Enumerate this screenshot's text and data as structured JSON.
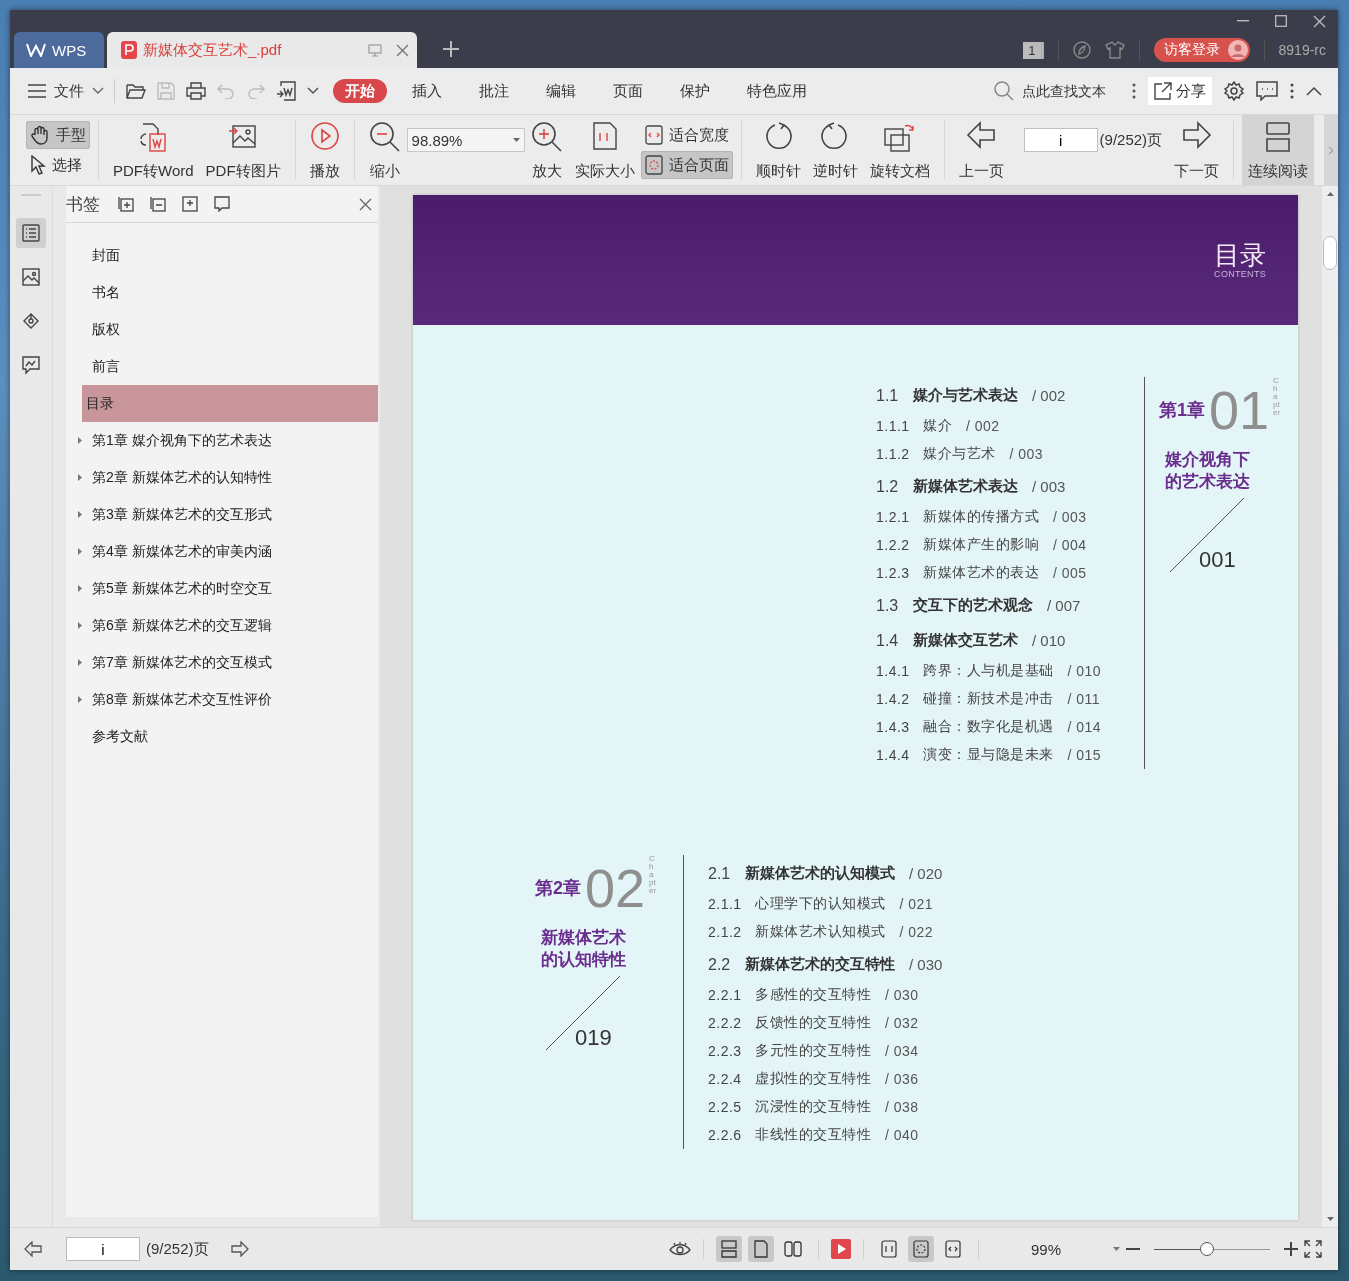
{
  "title_bar": {
    "tabs": [
      {
        "label": "WPS",
        "kind": "home",
        "selected": false
      },
      {
        "label": "新媒体交互艺术_.pdf",
        "kind": "doc",
        "selected": true
      }
    ],
    "counter": "1",
    "login": "访客登录",
    "user": "8919-rc"
  },
  "menu": {
    "file": "文件",
    "quick_tools": [
      {
        "disabled": false
      },
      {
        "disabled": true
      },
      {
        "disabled": false
      },
      {
        "disabled": true
      },
      {
        "disabled": true
      },
      {
        "disabled": false
      }
    ],
    "tabs": [
      {
        "label": "开始",
        "selected": true
      },
      {
        "label": "插入",
        "selected": false
      },
      {
        "label": "批注",
        "selected": false
      },
      {
        "label": "编辑",
        "selected": false
      },
      {
        "label": "页面",
        "selected": false
      },
      {
        "label": "保护",
        "selected": false
      },
      {
        "label": "特色应用",
        "selected": false
      }
    ],
    "search": {
      "placeholder": "点此查找文本"
    },
    "share": "分享"
  },
  "toolbar": [
    [
      {
        "kind": "pair",
        "items": [
          {
            "label": "手型",
            "selected": true
          },
          {
            "label": "选择",
            "selected": false
          }
        ]
      }
    ],
    [
      {
        "kind": "big",
        "label": "PDF转Word"
      },
      {
        "kind": "big",
        "label": "PDF转图片"
      }
    ],
    [
      {
        "kind": "big",
        "label": "播放"
      }
    ],
    [
      {
        "kind": "big",
        "label": "缩小"
      },
      {
        "kind": "zoom",
        "value": "98.89%"
      },
      {
        "kind": "big",
        "label": "放大"
      },
      {
        "kind": "big",
        "label": "实际大小"
      },
      {
        "kind": "pair",
        "items": [
          {
            "label": "适合宽度",
            "selected": false
          },
          {
            "label": "适合页面",
            "selected": true
          }
        ]
      }
    ],
    [
      {
        "kind": "big",
        "label": "顺时针"
      },
      {
        "kind": "big",
        "label": "逆时针"
      },
      {
        "kind": "big",
        "label": "旋转文档"
      }
    ],
    [
      {
        "kind": "big",
        "label": "上一页"
      },
      {
        "kind": "page",
        "value": "i",
        "total": "(9/252)页"
      },
      {
        "kind": "big",
        "label": "下一页"
      }
    ],
    [
      {
        "kind": "big",
        "label": "连续阅读",
        "on": true
      }
    ]
  ],
  "rail": [
    {
      "selected": true
    },
    {
      "selected": false
    },
    {
      "selected": false
    },
    {
      "selected": false
    }
  ],
  "sidebar": {
    "title": "书签",
    "items": [
      {
        "label": "封面",
        "expandable": false,
        "selected": false
      },
      {
        "label": "书名",
        "expandable": false,
        "selected": false
      },
      {
        "label": "版权",
        "expandable": false,
        "selected": false
      },
      {
        "label": "前言",
        "expandable": false,
        "selected": false
      },
      {
        "label": "目录",
        "expandable": false,
        "selected": true
      },
      {
        "label": "第1章 媒介视角下的艺术表达",
        "expandable": true,
        "selected": false
      },
      {
        "label": "第2章 新媒体艺术的认知特性",
        "expandable": true,
        "selected": false
      },
      {
        "label": "第3章 新媒体艺术的交互形式",
        "expandable": true,
        "selected": false
      },
      {
        "label": "第4章 新媒体艺术的审美内涵",
        "expandable": true,
        "selected": false
      },
      {
        "label": "第5章 新媒体艺术的时空交互",
        "expandable": true,
        "selected": false
      },
      {
        "label": "第6章 新媒体艺术的交互逻辑",
        "expandable": true,
        "selected": false
      },
      {
        "label": "第7章 新媒体艺术的交互模式",
        "expandable": true,
        "selected": false
      },
      {
        "label": "第8章 新媒体艺术交互性评价",
        "expandable": true,
        "selected": false
      },
      {
        "label": "参考文献",
        "expandable": false,
        "selected": false
      }
    ]
  },
  "page": {
    "title": "目录",
    "subtitle": "CONTENTS",
    "chapters": [
      {
        "kind": "list-first",
        "digits": "01",
        "chapter_word": "Chapter",
        "label": "第1章",
        "title_lines": [
          "媒介视角下",
          "的艺术表达"
        ],
        "page": "001",
        "entries": [
          {
            "kind": "section",
            "num": "1.1",
            "title": "媒介与艺术表达",
            "page": "/ 002"
          },
          {
            "kind": "sub",
            "num": "1.1.1",
            "title": "媒介",
            "page": "/ 002"
          },
          {
            "kind": "sub",
            "num": "1.1.2",
            "title": "媒介与艺术",
            "page": "/ 003"
          },
          {
            "kind": "section",
            "num": "1.2",
            "title": "新媒体艺术表达",
            "page": "/ 003"
          },
          {
            "kind": "sub",
            "num": "1.2.1",
            "title": "新媒体的传播方式",
            "page": "/ 003"
          },
          {
            "kind": "sub",
            "num": "1.2.2",
            "title": "新媒体产生的影响",
            "page": "/ 004"
          },
          {
            "kind": "sub",
            "num": "1.2.3",
            "title": "新媒体艺术的表达",
            "page": "/ 005"
          },
          {
            "kind": "section",
            "num": "1.3",
            "title": "交互下的艺术观念",
            "page": "/ 007"
          },
          {
            "kind": "section",
            "num": "1.4",
            "title": "新媒体交互艺术",
            "page": "/ 010"
          },
          {
            "kind": "sub",
            "num": "1.4.1",
            "title": "跨界：人与机是基础",
            "page": "/ 010"
          },
          {
            "kind": "sub",
            "num": "1.4.2",
            "title": "碰撞：新技术是冲击",
            "page": "/ 011"
          },
          {
            "kind": "sub",
            "num": "1.4.3",
            "title": "融合：数字化是机遇",
            "page": "/ 014"
          },
          {
            "kind": "sub",
            "num": "1.4.4",
            "title": "演变：显与隐是未来",
            "page": "/ 015"
          }
        ]
      },
      {
        "kind": "badge-first",
        "digits": "02",
        "chapter_word": "Chapter",
        "label": "第2章",
        "title_lines": [
          "新媒体艺术",
          "的认知特性"
        ],
        "page": "019",
        "entries": [
          {
            "kind": "section",
            "num": "2.1",
            "title": "新媒体艺术的认知模式",
            "page": "/ 020"
          },
          {
            "kind": "sub",
            "num": "2.1.1",
            "title": "心理学下的认知模式",
            "page": "/ 021"
          },
          {
            "kind": "sub",
            "num": "2.1.2",
            "title": "新媒体艺术认知模式",
            "page": "/ 022"
          },
          {
            "kind": "section",
            "num": "2.2",
            "title": "新媒体艺术的交互特性",
            "page": "/ 030"
          },
          {
            "kind": "sub",
            "num": "2.2.1",
            "title": "多感性的交互特性",
            "page": "/ 030"
          },
          {
            "kind": "sub",
            "num": "2.2.2",
            "title": "反馈性的交互特性",
            "page": "/ 032"
          },
          {
            "kind": "sub",
            "num": "2.2.3",
            "title": "多元性的交互特性",
            "page": "/ 034"
          },
          {
            "kind": "sub",
            "num": "2.2.4",
            "title": "虚拟性的交互特性",
            "page": "/ 036"
          },
          {
            "kind": "sub",
            "num": "2.2.5",
            "title": "沉浸性的交互特性",
            "page": "/ 038"
          },
          {
            "kind": "sub",
            "num": "2.2.6",
            "title": "非线性的交互特性",
            "page": "/ 040"
          }
        ]
      }
    ]
  },
  "status_bar": {
    "page_value": "i",
    "page_total": "(9/252)页",
    "view_modes": [
      {
        "selected": true
      },
      {
        "selected": true
      },
      {
        "selected": false
      }
    ],
    "fit_modes": [
      {
        "selected": false
      },
      {
        "selected": true
      },
      {
        "selected": false
      }
    ],
    "zoom": "99%",
    "zoom_slider": {
      "level": 0.46
    }
  }
}
